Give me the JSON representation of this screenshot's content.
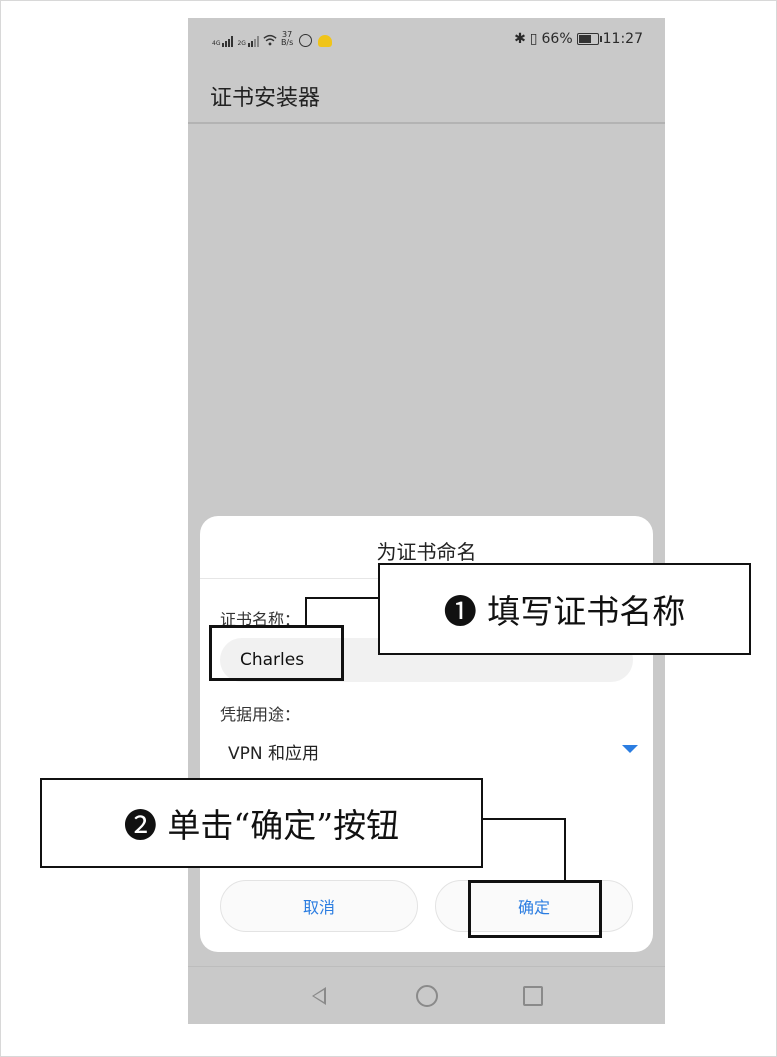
{
  "status_bar": {
    "network_1": "4G",
    "network_2": "2G",
    "speed_value": "37",
    "speed_unit": "B/s",
    "battery": "66%",
    "time": "11:27"
  },
  "app": {
    "title": "证书安装器"
  },
  "dialog": {
    "title": "为证书命名",
    "name_label": "证书名称：",
    "name_value": "Charles",
    "usage_label": "凭据用途：",
    "usage_value": "VPN 和应用",
    "cancel_label": "取消",
    "ok_label": "确定"
  },
  "annotations": {
    "step1": "❶ 填写证书名称",
    "step2": "❷ 单击“确定”按钮"
  },
  "colors": {
    "accent": "#2b7de1",
    "screen_dim": "#c9c9c9",
    "dialog_bg": "#ffffff"
  }
}
